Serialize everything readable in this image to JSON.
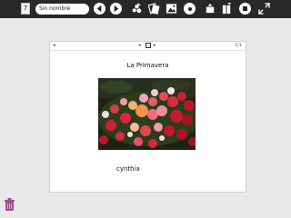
{
  "toolbar": {
    "title_value": "Sin nombre",
    "activity_icon": "journal-icon",
    "icons": {
      "back": "arrow-left-icon",
      "forward": "arrow-right-icon",
      "share": "share-icon",
      "keep": "keep-icon",
      "view": "photo-view-icon",
      "record": "record-icon",
      "insert": "insert-image-icon",
      "textbox": "text-icon",
      "stop": "stop-icon",
      "fullscreen": "fullscreen-icon"
    }
  },
  "slide": {
    "counter": "1/1",
    "title": "La Primavera",
    "caption": "cynthia",
    "photo_icon": "flower-photo"
  },
  "colors": {
    "toolbar_bg": "#282828",
    "desktop_bg": "#e8e8e8",
    "trash_color": "#a0508a"
  }
}
